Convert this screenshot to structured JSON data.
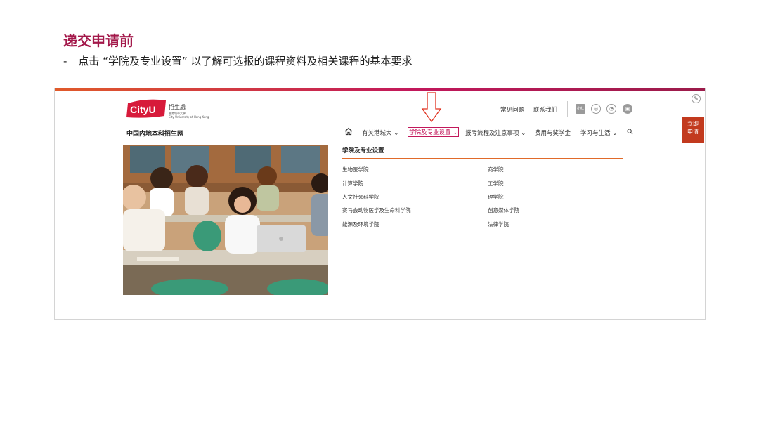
{
  "slide": {
    "title": "递交申请前",
    "bullet_dash": "-",
    "instruction": "点击 “学院及专业设置” 以了解可选报的课程资料及相关课程的基本要求"
  },
  "header": {
    "logo_text": "CityU",
    "office_label": "招生處",
    "university_cn": "香港城市大學",
    "university_en": "City University of Hong Kong",
    "utility_links": [
      "常见问题",
      "联系我们"
    ],
    "social_icons": [
      "xiaohongshu-icon",
      "weibo-icon",
      "wechat-icon",
      "bilibili-icon"
    ],
    "social_badge_text": "小红书"
  },
  "nav": {
    "site_title": "中国内地本科招生网",
    "items": [
      {
        "label": "有关港城大 ⌄"
      },
      {
        "label": "学院及专业设置 ⌄"
      },
      {
        "label": "报考流程及注意事项 ⌄"
      },
      {
        "label": "费用与奖学金"
      },
      {
        "label": "学习与生活 ⌄"
      }
    ]
  },
  "apply_button": {
    "line1": "立即",
    "line2": "申请"
  },
  "dropdown": {
    "title": "学院及专业设置",
    "left_column": [
      "生物医学院",
      "计算学院",
      "人文社会科学院",
      "赛马会动物医学及生命科学院",
      "能源及环境学院"
    ],
    "right_column": [
      "商学院",
      "工学院",
      "理学院",
      "创意媒体学院",
      "法律学院"
    ]
  },
  "colors": {
    "accent": "#a3184a",
    "nav_active": "#c2185b",
    "apply_bg": "#c23a1e",
    "logo_red": "#d71a3a"
  }
}
